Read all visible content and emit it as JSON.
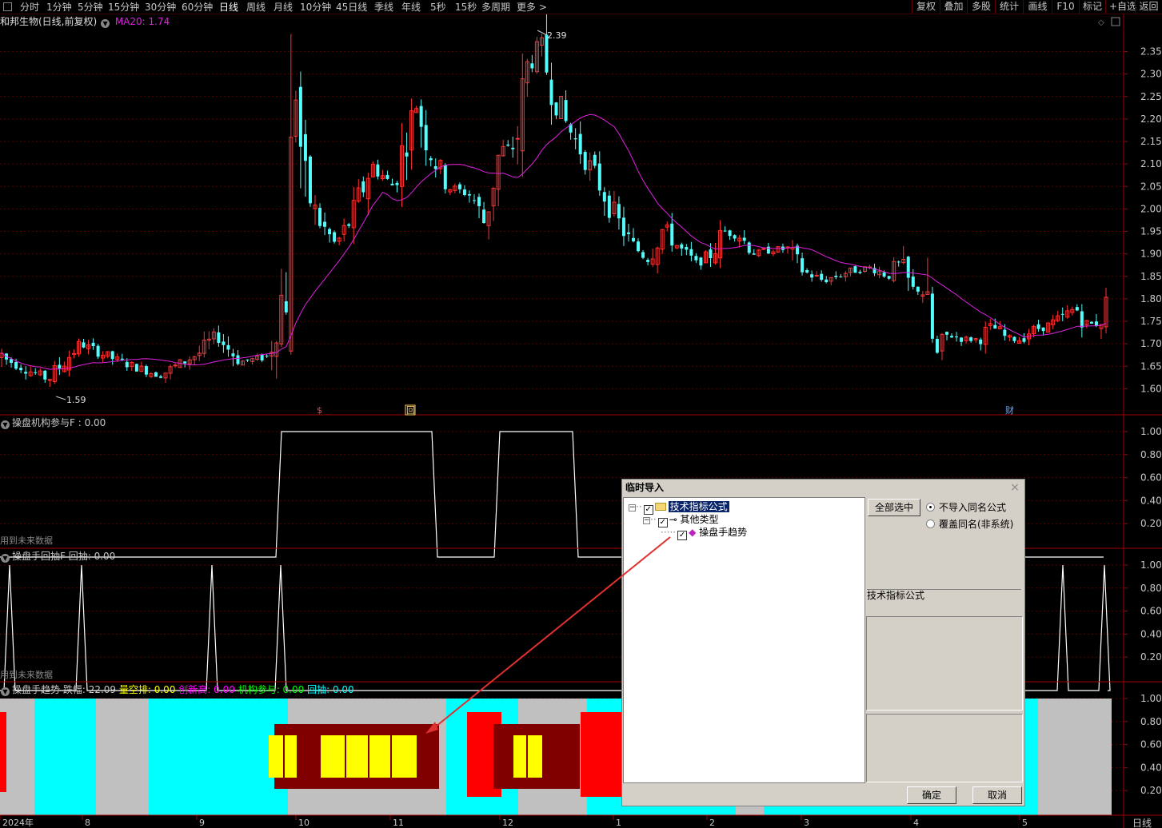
{
  "toolbar": {
    "left": [
      "分时",
      "1分钟",
      "5分钟",
      "15分钟",
      "30分钟",
      "60分钟",
      "日线",
      "周线",
      "月线",
      "10分钟",
      "45日线",
      "季线",
      "年线",
      "5秒",
      "15秒",
      "多周期",
      "更多 >"
    ],
    "active": "日线",
    "right": [
      "复权",
      "叠加",
      "多股",
      "统计",
      "画线",
      "F10",
      "标记",
      "+自选",
      "返回"
    ]
  },
  "main_panel": {
    "title": "和邦生物(日线,前复权)",
    "ma_label": "MA20: 1.74",
    "max_label": "2.39",
    "min_label": "1.59",
    "markers": [
      "$",
      "回",
      "财"
    ],
    "y_ticks": [
      "2.35",
      "2.30",
      "2.25",
      "2.20",
      "2.15",
      "2.10",
      "2.05",
      "2.00",
      "1.95",
      "1.90",
      "1.85",
      "1.80",
      "1.75",
      "1.70",
      "1.65",
      "1.60"
    ]
  },
  "panel2": {
    "title": "操盘机构参与F : 0.00",
    "note": "用到未来数据",
    "y_ticks": [
      "1.00",
      "0.80",
      "0.60",
      "0.40",
      "0.20"
    ]
  },
  "panel3": {
    "title": "操盘手回抽F  回抽: 0.00",
    "note": "用到未来数据",
    "y_ticks": [
      "1.00",
      "0.80",
      "0.60",
      "0.40",
      "0.20"
    ]
  },
  "panel4": {
    "title": "操盘手趋势",
    "items": [
      {
        "label": "跌幅: 22.09",
        "color": "#c8c8c8"
      },
      {
        "label": "量空排: 0.00",
        "color": "#ffff00"
      },
      {
        "label": "创新高: 0.00",
        "color": "#ff00ff"
      },
      {
        "label": "机构参与: 0.00",
        "color": "#00ff00"
      },
      {
        "label": "回抽: 0.00",
        "color": "#00ffff"
      }
    ],
    "y_ticks": [
      "1.00",
      "0.80",
      "0.60",
      "0.40",
      "0.20"
    ]
  },
  "x_axis": {
    "labels": [
      "2024年",
      "8",
      "9",
      "10",
      "11",
      "12",
      "1",
      "2",
      "3",
      "4",
      "5"
    ],
    "period": "日线"
  },
  "dialog": {
    "title": "临时导入",
    "close": "×",
    "tree": {
      "root": "技术指标公式",
      "child": "其他类型",
      "leaf": "操盘手趋势"
    },
    "select_all": "全部选中",
    "radio1": "不导入同名公式",
    "radio2": "覆盖同名(非系统)",
    "info_label": "技术指标公式",
    "ok": "确定",
    "cancel": "取消"
  },
  "colors": {
    "up": "#ff3232",
    "down": "#54fcfc",
    "ma": "#e020e0",
    "grid": "#5a0000",
    "axis": "#a00000"
  }
}
